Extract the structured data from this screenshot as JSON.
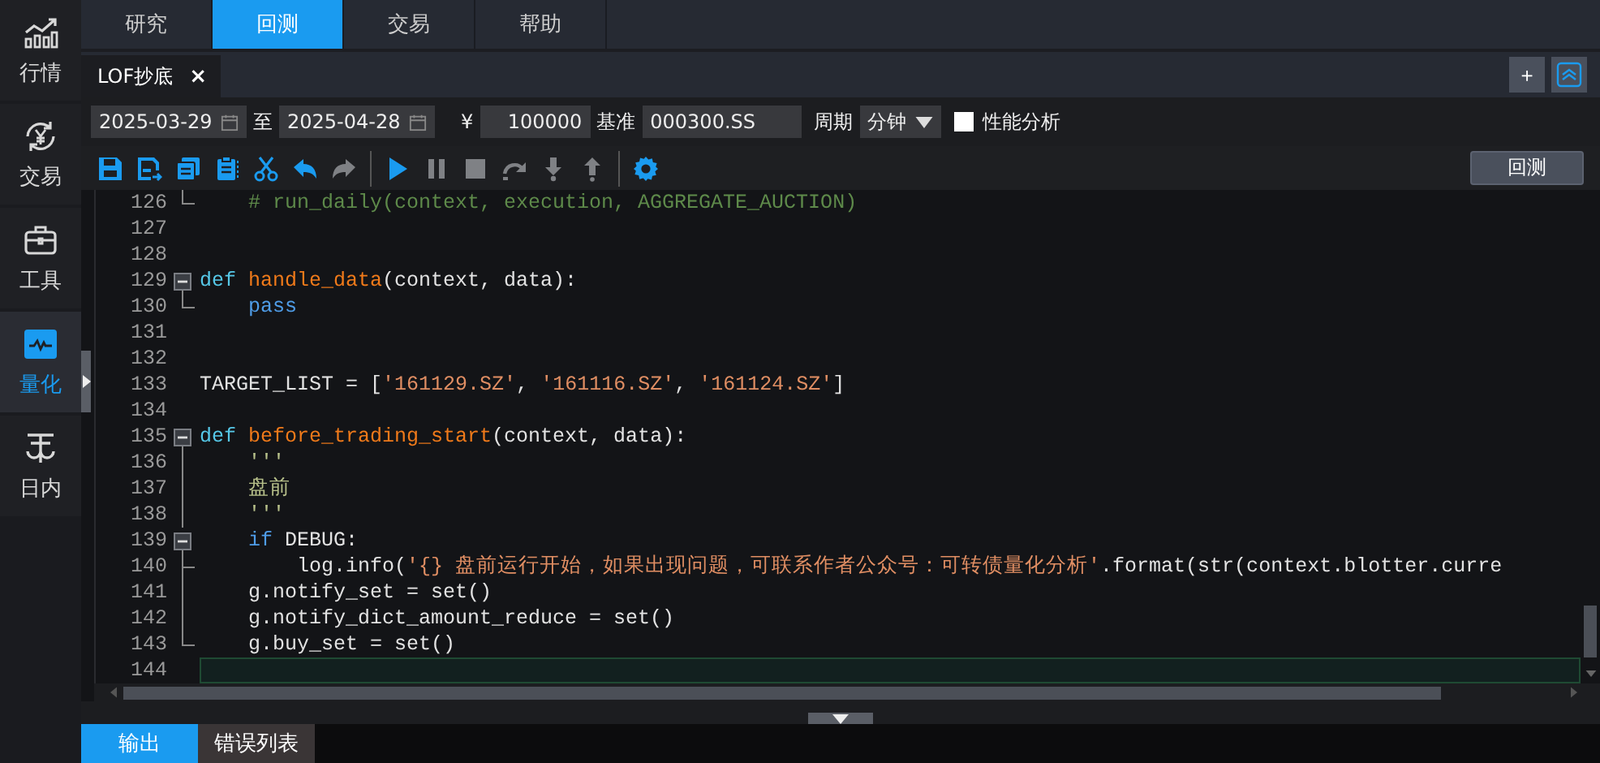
{
  "sidebar": {
    "items": [
      {
        "kind": "chart",
        "label": "行情",
        "selected": false
      },
      {
        "kind": "exchange",
        "label": "交易",
        "selected": false
      },
      {
        "kind": "toolbox",
        "label": "工具",
        "selected": false
      },
      {
        "kind": "pulse",
        "label": "量化",
        "selected": true
      },
      {
        "kind": "scale",
        "label": "日内",
        "selected": false
      }
    ]
  },
  "top_tabs": [
    {
      "label": "研究",
      "selected": false
    },
    {
      "label": "回测",
      "selected": true
    },
    {
      "label": "交易",
      "selected": false
    },
    {
      "label": "帮助",
      "selected": false
    }
  ],
  "file_tab": {
    "label": "LOF抄底",
    "close": "×"
  },
  "add_button": "+",
  "settings": {
    "start_date": "2025-03-29",
    "to_label": "至",
    "end_date": "2025-04-28",
    "currency": "¥",
    "capital": "100000",
    "benchmark_label": "基准",
    "benchmark": "000300.SS",
    "period_label": "周期",
    "period": "分钟",
    "profiling": {
      "label": "性能分析",
      "checked": false
    }
  },
  "toolbar": {
    "groups": [
      [
        {
          "kind": "save",
          "disabled": false
        },
        {
          "kind": "save-as",
          "disabled": false
        },
        {
          "kind": "copy",
          "disabled": false
        },
        {
          "kind": "paste",
          "disabled": false
        },
        {
          "kind": "cut",
          "disabled": false
        },
        {
          "kind": "undo",
          "disabled": false
        },
        {
          "kind": "redo",
          "disabled": true
        }
      ],
      [
        {
          "kind": "run",
          "disabled": false
        },
        {
          "kind": "pause",
          "disabled": true
        },
        {
          "kind": "stop",
          "disabled": true
        },
        {
          "kind": "step-over",
          "disabled": true
        },
        {
          "kind": "step-into",
          "disabled": true
        },
        {
          "kind": "step-out",
          "disabled": true
        }
      ],
      [
        {
          "kind": "settings",
          "disabled": false
        }
      ]
    ]
  },
  "run_button": "回测",
  "editor": {
    "lines": [
      {
        "number": "126",
        "kind": "end",
        "current": false,
        "tokens": [
          {
            "kind": "comment",
            "text": "    # run_daily(context, execution, AGGREGATE_AUCTION)"
          }
        ]
      },
      {
        "number": "127",
        "current": false
      },
      {
        "number": "128",
        "current": false
      },
      {
        "number": "129",
        "kind": "open",
        "current": false,
        "tokens": [
          {
            "kind": "def",
            "text": "def "
          },
          {
            "kind": "function",
            "text": "handle_data"
          },
          {
            "kind": "plain",
            "text": "(context, data):"
          }
        ]
      },
      {
        "number": "130",
        "kind": "end",
        "current": false,
        "tokens": [
          {
            "kind": "keyword",
            "text": "    pass"
          }
        ]
      },
      {
        "number": "131",
        "current": false
      },
      {
        "number": "132",
        "current": false
      },
      {
        "number": "133",
        "current": false,
        "tokens": [
          {
            "kind": "plain",
            "text": "TARGET_LIST = ["
          },
          {
            "kind": "string",
            "text": "'161129.SZ'"
          },
          {
            "kind": "plain",
            "text": ", "
          },
          {
            "kind": "string",
            "text": "'161116.SZ'"
          },
          {
            "kind": "plain",
            "text": ", "
          },
          {
            "kind": "string",
            "text": "'161124.SZ'"
          },
          {
            "kind": "plain",
            "text": "]"
          }
        ]
      },
      {
        "number": "134",
        "current": false
      },
      {
        "number": "135",
        "kind": "open",
        "current": false,
        "tokens": [
          {
            "kind": "def",
            "text": "def "
          },
          {
            "kind": "function",
            "text": "before_trading_start"
          },
          {
            "kind": "plain",
            "text": "(context, data):"
          }
        ]
      },
      {
        "number": "136",
        "kind": "line",
        "current": false,
        "tokens": [
          {
            "kind": "docstring",
            "text": "    '''"
          }
        ]
      },
      {
        "number": "137",
        "kind": "line",
        "current": false,
        "tokens": [
          {
            "kind": "docstring",
            "text": "    盘前"
          }
        ]
      },
      {
        "number": "138",
        "kind": "line",
        "current": false,
        "tokens": [
          {
            "kind": "docstring",
            "text": "    '''"
          }
        ]
      },
      {
        "number": "139",
        "kind": "open",
        "current": false,
        "tokens": [
          {
            "kind": "keyword",
            "text": "    if "
          },
          {
            "kind": "plain",
            "text": "DEBUG:"
          }
        ]
      },
      {
        "number": "140",
        "kind": "tee",
        "current": false,
        "tokens": [
          {
            "kind": "plain",
            "text": "        log.info("
          },
          {
            "kind": "string",
            "text": "'{} 盘前运行开始，如果出现问题，可联系作者公众号：可转债量化分析'"
          },
          {
            "kind": "plain",
            "text": ".format(str(context.blotter.curre"
          }
        ]
      },
      {
        "number": "141",
        "kind": "line",
        "current": false,
        "tokens": [
          {
            "kind": "plain",
            "text": "    g.notify_set = set()"
          }
        ]
      },
      {
        "number": "142",
        "kind": "line",
        "current": false,
        "tokens": [
          {
            "kind": "plain",
            "text": "    g.notify_dict_amount_reduce = set()"
          }
        ]
      },
      {
        "number": "143",
        "kind": "end",
        "current": false,
        "tokens": [
          {
            "kind": "plain",
            "text": "    g.buy_set = set()"
          }
        ]
      },
      {
        "number": "144",
        "current": true
      }
    ]
  },
  "bottom_tabs": [
    {
      "label": "输出",
      "selected": true
    },
    {
      "label": "错误列表",
      "selected": false
    }
  ]
}
